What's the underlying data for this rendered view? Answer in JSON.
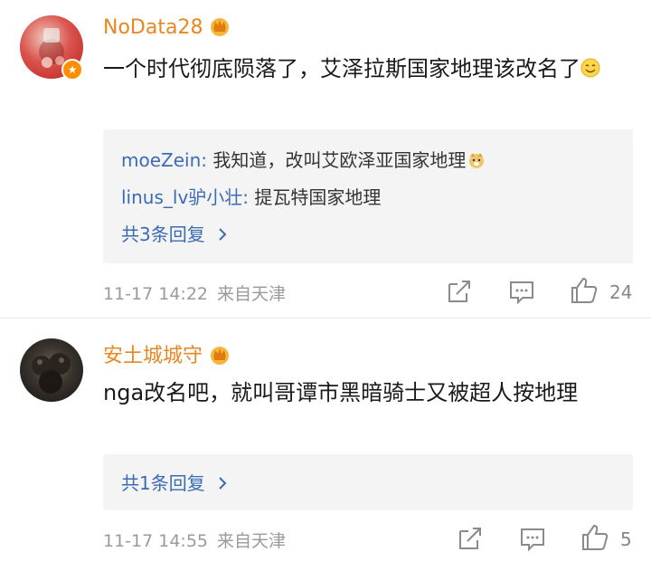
{
  "comments": [
    {
      "username": "NoData28",
      "text": "一个时代彻底陨落了，艾泽拉斯国家地理该改名了",
      "replies": [
        {
          "author": "moeZein",
          "text": "我知道，改叫艾欧泽亚国家地理"
        },
        {
          "author": "linus_lv驴小壮",
          "text": "提瓦特国家地理"
        }
      ],
      "more_replies": "共3条回复",
      "time": "11-17 14:22",
      "location": "来自天津",
      "likes": "24"
    },
    {
      "username": "安土城城守",
      "text": "nga改名吧，就叫哥谭市黑暗骑士又被超人按地理",
      "replies": [],
      "more_replies": "共1条回复",
      "time": "11-17 14:55",
      "location": "来自天津",
      "likes": "5"
    }
  ],
  "icons": {
    "share": "share-icon",
    "comment": "comment-icon",
    "like": "thumbs-up-icon",
    "chevron": "chevron-right-icon",
    "crown": "crown-badge-icon"
  },
  "colors": {
    "username": "#e98623",
    "link": "#3c6bb6",
    "meta": "#9a9a9a",
    "reply_bg": "#f4f4f4"
  }
}
